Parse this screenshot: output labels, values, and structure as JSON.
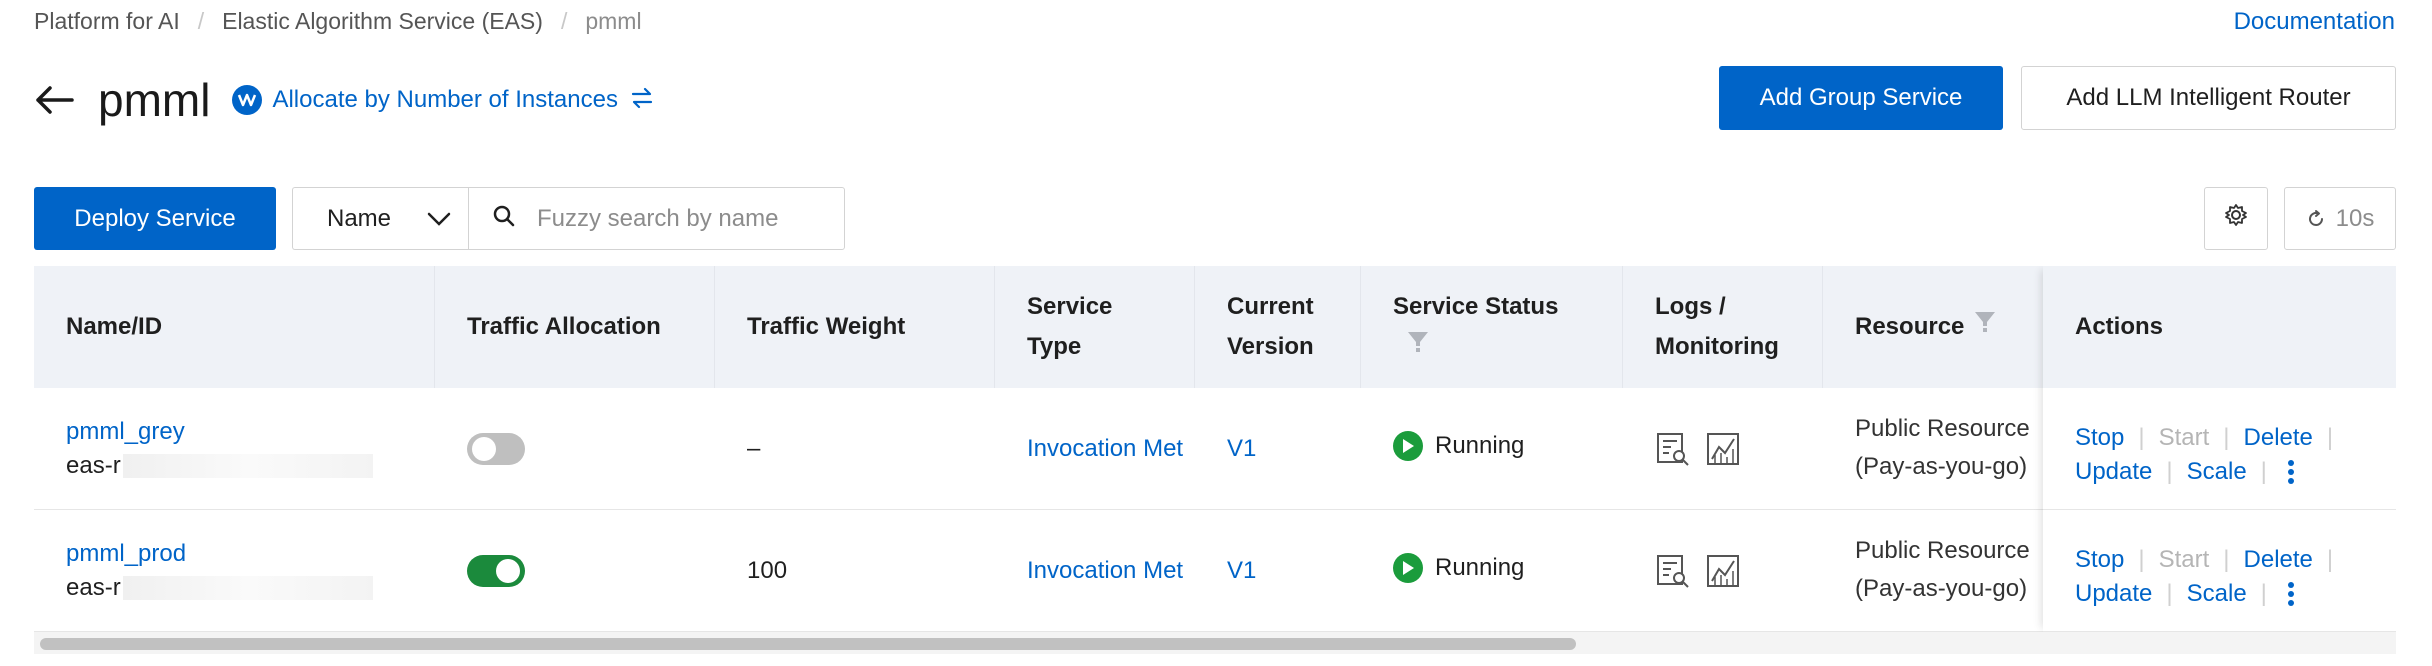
{
  "breadcrumb": [
    "Platform for AI",
    "Elastic Algorithm Service (EAS)",
    "pmml"
  ],
  "documentation_link": "Documentation",
  "page": {
    "title": "pmml",
    "allocation_label": "Allocate by Number of Instances"
  },
  "header_buttons": {
    "add_group": "Add Group Service",
    "add_router": "Add LLM Intelligent Router"
  },
  "toolbar": {
    "deploy": "Deploy Service",
    "filter_field": "Name",
    "search_placeholder": "Fuzzy search by name",
    "refresh_interval": "10s"
  },
  "table": {
    "columns": {
      "name": "Name/ID",
      "traffic_allocation": "Traffic Allocation",
      "traffic_weight": "Traffic Weight",
      "service_type_1": "Service",
      "service_type_2": "Type",
      "current_version_1": "Current",
      "current_version_2": "Version",
      "service_status": "Service Status",
      "logs_1": "Logs /",
      "logs_2": "Monitoring",
      "resource": "Resource",
      "actions": "Actions"
    },
    "rows": [
      {
        "name": "pmml_grey",
        "id_prefix": "eas-r",
        "traffic_on": false,
        "weight": "–",
        "service_type": "Invocation Met",
        "version": "V1",
        "status": "Running",
        "resource_1": "Public Resource",
        "resource_2": "(Pay-as-you-go)"
      },
      {
        "name": "pmml_prod",
        "id_prefix": "eas-r",
        "traffic_on": true,
        "weight": "100",
        "service_type": "Invocation Met",
        "version": "V1",
        "status": "Running",
        "resource_1": "Public Resource",
        "resource_2": "(Pay-as-you-go)"
      }
    ],
    "actions": {
      "stop": "Stop",
      "start": "Start",
      "delete": "Delete",
      "update": "Update",
      "scale": "Scale"
    }
  },
  "colors": {
    "primary": "#0064c8",
    "running": "#1b9c3c",
    "toggle_on": "#1b8a3c",
    "toggle_off": "#bfbfbf",
    "header_bg": "#eff2f7"
  }
}
